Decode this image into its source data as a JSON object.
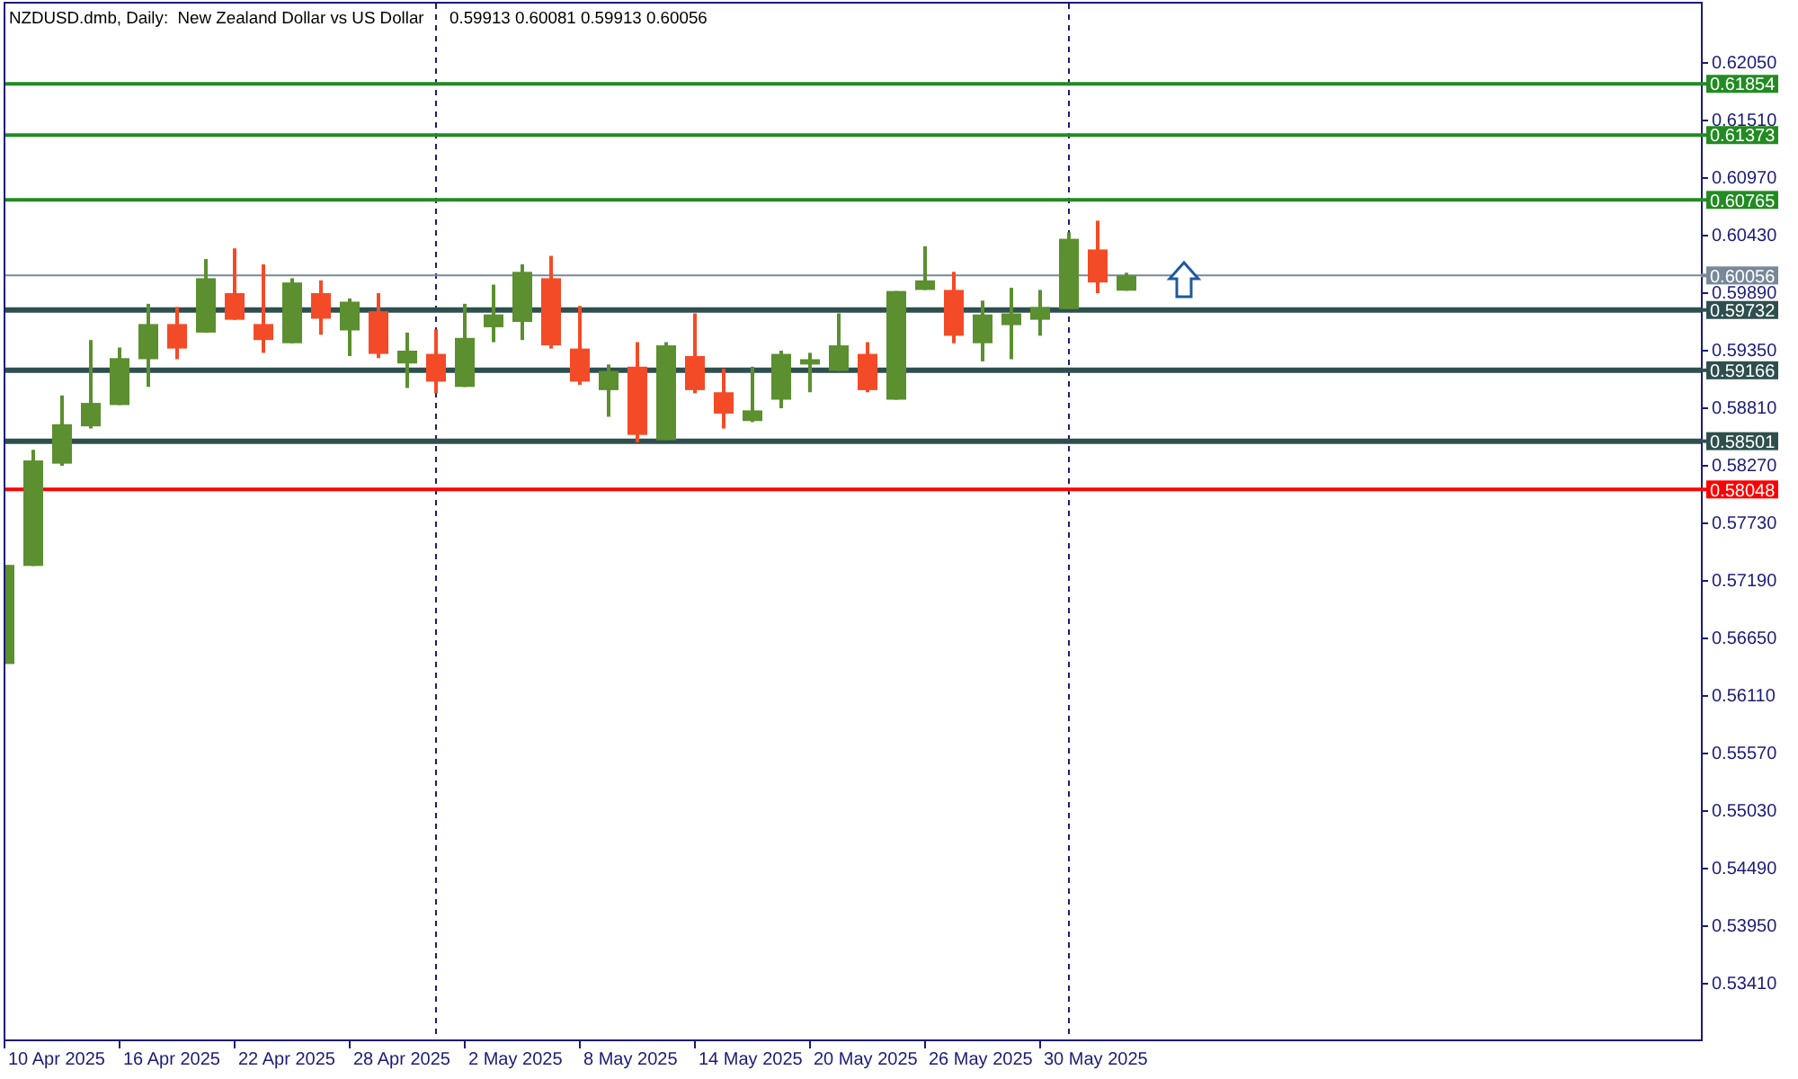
{
  "header": {
    "title": "NZDUSD.dmb, Daily:  New Zealand Dollar vs US Dollar",
    "ohlc": "0.59913 0.60081 0.59913 0.60056"
  },
  "price_axis": {
    "labels": [
      "0.62050",
      "0.61510",
      "0.60970",
      "0.60430",
      "0.59890",
      "0.59350",
      "0.58810",
      "0.58270",
      "0.57730",
      "0.57190",
      "0.56650",
      "0.56110",
      "0.55570",
      "0.55030",
      "0.54490",
      "0.53950",
      "0.53410"
    ]
  },
  "price_levels": [
    {
      "label": "0.61854",
      "color": "#228b22"
    },
    {
      "label": "0.61373",
      "color": "#228b22"
    },
    {
      "label": "0.60765",
      "color": "#228b22"
    },
    {
      "label": "0.60056",
      "color": "#778899"
    },
    {
      "label": "0.59732",
      "color": "#2f4f4f"
    },
    {
      "label": "0.59166",
      "color": "#2f4f4f"
    },
    {
      "label": "0.58501",
      "color": "#2f4f4f"
    },
    {
      "label": "0.58048",
      "color": "#ff0000"
    }
  ],
  "date_axis": {
    "labels": [
      "10 Apr 2025",
      "16 Apr 2025",
      "22 Apr 2025",
      "28 Apr 2025",
      "2 May 2025",
      "8 May 2025",
      "14 May 2025",
      "20 May 2025",
      "26 May 2025",
      "30 May 2025"
    ]
  }
}
